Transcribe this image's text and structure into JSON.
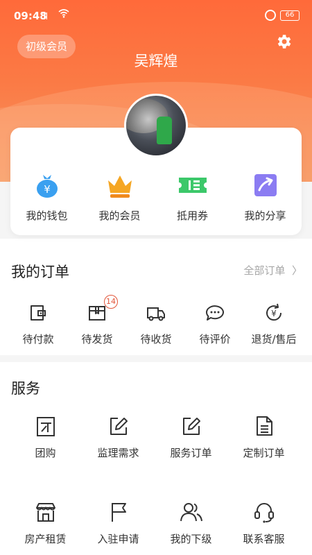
{
  "status_bar": {
    "time": "09:48",
    "signal": "᪲ıl",
    "battery": "66"
  },
  "header": {
    "level_badge": "初级会员",
    "username": "吴辉煌"
  },
  "quick_actions": [
    {
      "label": "我的钱包",
      "icon": "money-bag-icon",
      "color": "#3aa0f0"
    },
    {
      "label": "我的会员",
      "icon": "crown-icon",
      "color": "#f5a623"
    },
    {
      "label": "抵用券",
      "icon": "coupon-icon",
      "color": "#3cc86a"
    },
    {
      "label": "我的分享",
      "icon": "share-icon",
      "color": "#7b6cf0"
    }
  ],
  "orders": {
    "title": "我的订单",
    "all_link": "全部订单",
    "items": [
      {
        "label": "待付款",
        "icon": "wallet-icon"
      },
      {
        "label": "待发货",
        "icon": "package-icon",
        "badge": "14"
      },
      {
        "label": "待收货",
        "icon": "truck-icon"
      },
      {
        "label": "待评价",
        "icon": "comment-icon"
      },
      {
        "label": "退货/售后",
        "icon": "refund-icon"
      }
    ]
  },
  "services": {
    "title": "服务",
    "items": [
      {
        "label": "团购",
        "icon": "group-buy-icon"
      },
      {
        "label": "监理需求",
        "icon": "edit-icon"
      },
      {
        "label": "服务订单",
        "icon": "edit-doc-icon"
      },
      {
        "label": "定制订单",
        "icon": "document-icon"
      },
      {
        "label": "房产租赁",
        "icon": "store-icon"
      },
      {
        "label": "入驻申请",
        "icon": "flag-icon"
      },
      {
        "label": "我的下级",
        "icon": "users-icon"
      },
      {
        "label": "联系客服",
        "icon": "headset-icon"
      }
    ]
  },
  "colors": {
    "accent": "#fb7040",
    "badge": "#e2563a"
  }
}
